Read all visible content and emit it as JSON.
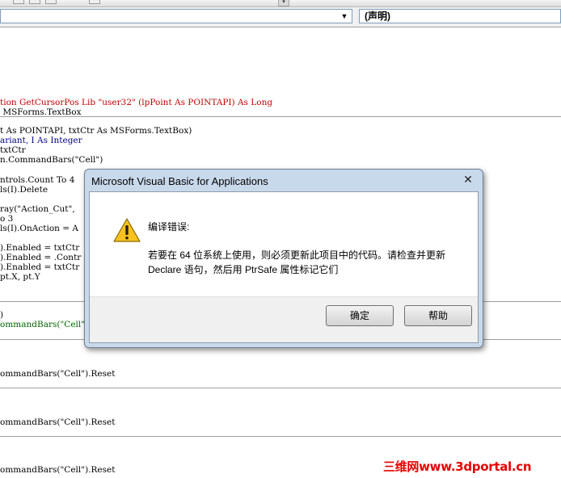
{
  "toolbar": {
    "scroll_arrow": "▾"
  },
  "combo": {
    "object_value": "",
    "object_arrow": "▼",
    "procedure_value": "(声明)"
  },
  "code": {
    "lines": [
      {
        "text": "tion GetCursorPos Lib \"user32\" (lpPoint As POINTAPI) As Long",
        "color": "#c00000"
      },
      {
        "text": " MSForms.TextBox",
        "color": "#000000"
      },
      {
        "text": "t As POINTAPI, txtCtr As MSForms.TextBox)",
        "color": "#000000"
      },
      {
        "text": "ariant, I As Integer",
        "color": "#00008b"
      },
      {
        "text": "txtCtr",
        "color": "#000000"
      },
      {
        "text": "n.CommandBars(\"Cell\")",
        "color": "#000000"
      },
      {
        "text": "ntrols.Count To 4",
        "color": "#000000"
      },
      {
        "text": "ls(I).Delete",
        "color": "#000000"
      },
      {
        "text": "ray(\"Action_Cut\",",
        "color": "#000000"
      },
      {
        "text": "o 3",
        "color": "#000000"
      },
      {
        "text": "ls(I).OnAction = A",
        "color": "#000000"
      },
      {
        "text": ").Enabled = txtCtr",
        "color": "#000000"
      },
      {
        "text": ").Enabled = .Contr",
        "color": "#000000"
      },
      {
        "text": ").Enabled = txtCtr",
        "color": "#000000"
      },
      {
        "text": "pt.X, pt.Y",
        "color": "#000000"
      },
      {
        "text": ")",
        "color": "#000000"
      },
      {
        "text": "ommandBars(\"Cell\").",
        "color": "#006400"
      },
      {
        "text": "ommandBars(\"Cell\").Reset",
        "color": "#000000"
      },
      {
        "text": "ommandBars(\"Cell\").Reset",
        "color": "#000000"
      },
      {
        "text": "ommandBars(\"Cell\").Reset",
        "color": "#000000"
      }
    ]
  },
  "dialog": {
    "title": "Microsoft Visual Basic for Applications",
    "close_glyph": "✕",
    "heading": "编译错误:",
    "message_line1": "若要在 64 位系统上使用，则必须更新此项目中的代码。请检查并更新",
    "message_line2": "Declare 语句，然后用 PtrSafe 属性标记它们",
    "ok_label": "确定",
    "help_label": "帮助",
    "icon": "warning-icon"
  },
  "watermark": "三维网www.3dportal.cn",
  "colors": {
    "keyword_blue": "#00008b",
    "error_red": "#c00000",
    "comment_green": "#006400",
    "watermark_red": "#e60000"
  }
}
